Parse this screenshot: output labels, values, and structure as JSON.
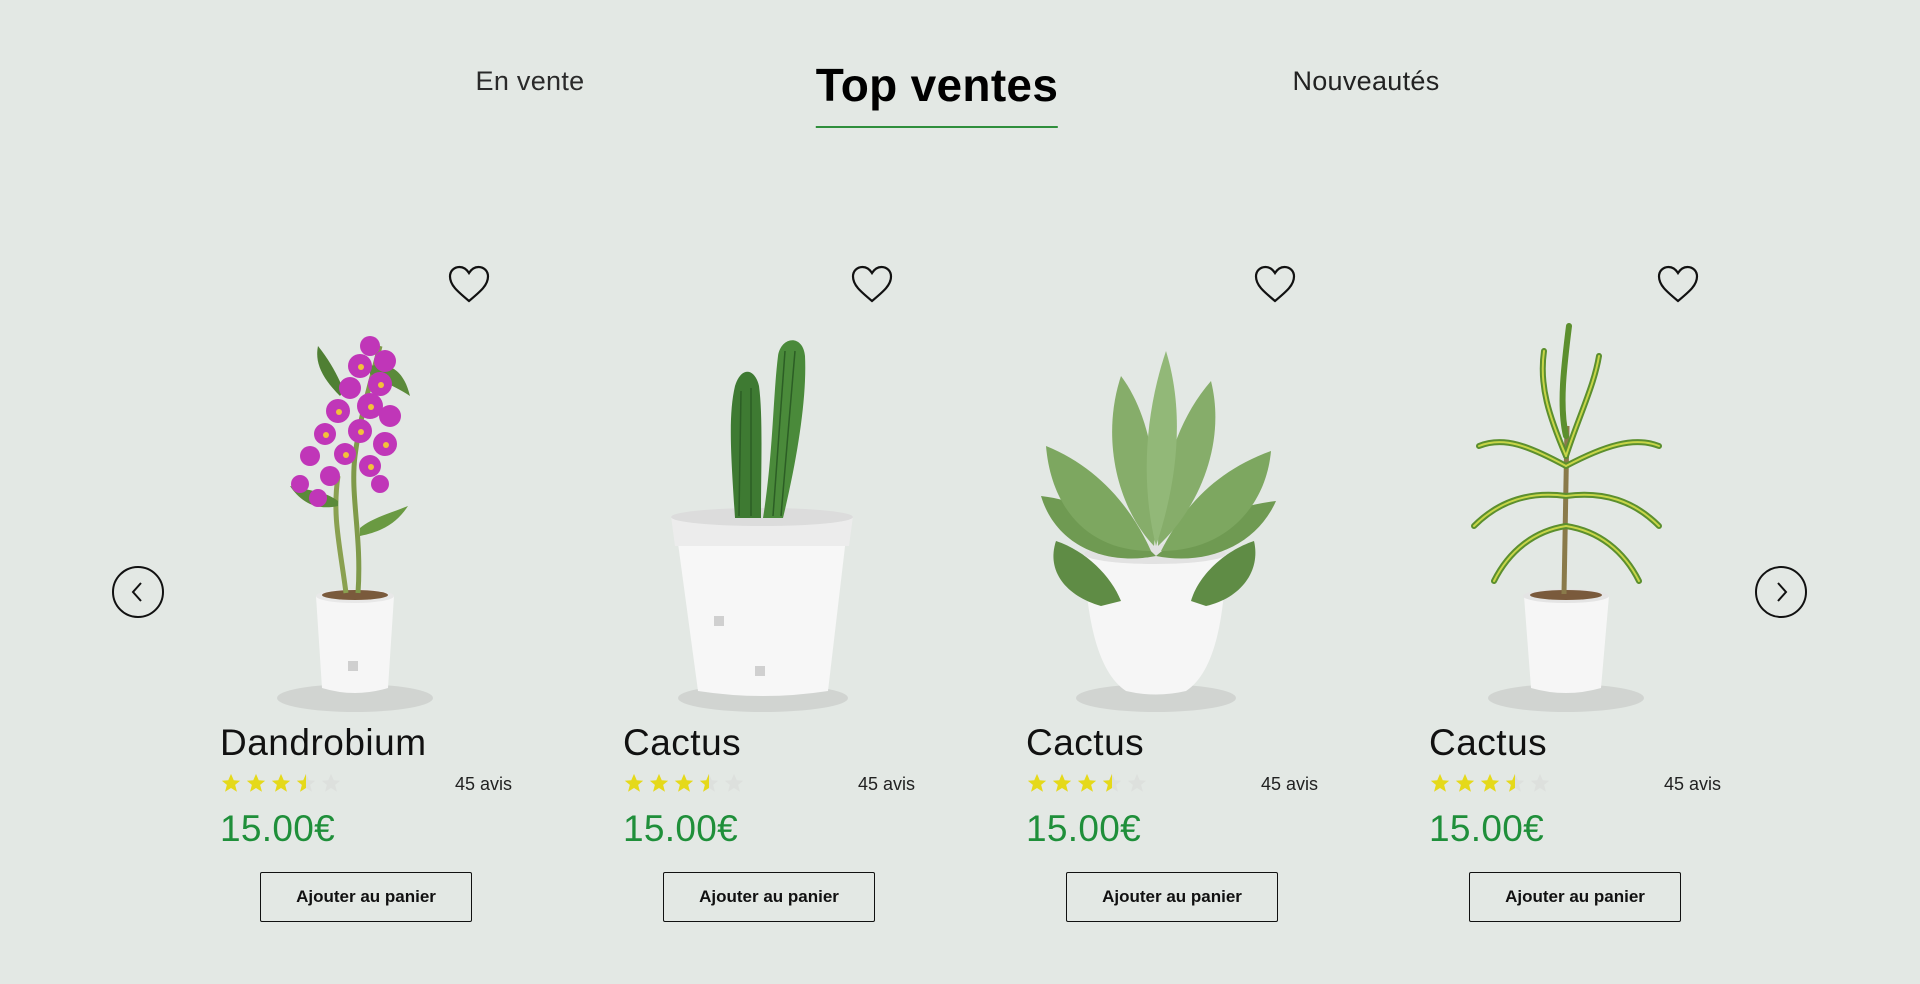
{
  "tabs": [
    {
      "label": "En vente"
    },
    {
      "label": "Top ventes",
      "active": true
    },
    {
      "label": "Nouveautés"
    }
  ],
  "carousel": {
    "prev_icon": "chevron-left-icon",
    "next_icon": "chevron-right-icon"
  },
  "colors": {
    "background": "#e3e8e4",
    "accent_green": "#2f8f3c",
    "price_green": "#1f8f3a",
    "star_yellow": "#e5d91a",
    "star_empty": "#dde0dd"
  },
  "products": [
    {
      "name": "Dandrobium",
      "rating": 3.5,
      "max_rating": 5,
      "reviews": "45 avis",
      "price": "15.00€",
      "button": "Ajouter au panier",
      "image": "orchid-plant"
    },
    {
      "name": "Cactus",
      "rating": 3.5,
      "max_rating": 5,
      "reviews": "45 avis",
      "price": "15.00€",
      "button": "Ajouter au panier",
      "image": "cactus-plant"
    },
    {
      "name": "Cactus",
      "rating": 3.5,
      "max_rating": 5,
      "reviews": "45 avis",
      "price": "15.00€",
      "button": "Ajouter au panier",
      "image": "succulent-plant"
    },
    {
      "name": "Cactus",
      "rating": 3.5,
      "max_rating": 5,
      "reviews": "45 avis",
      "price": "15.00€",
      "button": "Ajouter au panier",
      "image": "dracaena-plant"
    }
  ]
}
